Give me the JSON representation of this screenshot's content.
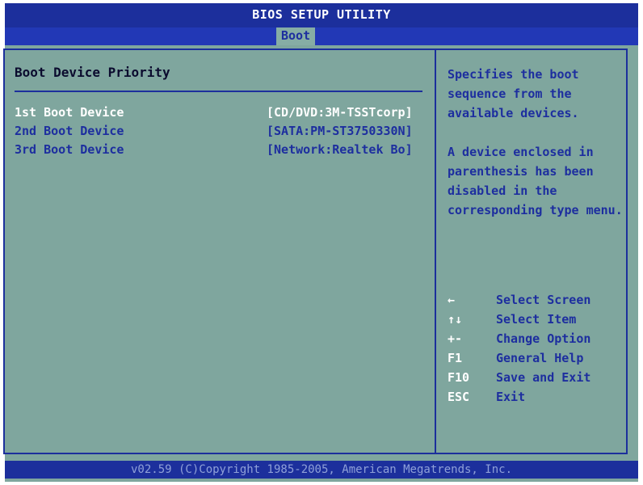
{
  "header": {
    "title": "BIOS SETUP UTILITY",
    "active_tab": "Boot"
  },
  "section": {
    "title": "Boot Device Priority"
  },
  "devices": [
    {
      "label": "1st Boot Device",
      "value": "[CD/DVD:3M-TSSTcorp]"
    },
    {
      "label": "2nd Boot Device",
      "value": "[SATA:PM-ST3750330N]"
    },
    {
      "label": "3rd Boot Device",
      "value": "[Network:Realtek Bo]"
    }
  ],
  "help": {
    "paragraph1": "Specifies the boot sequence from the available devices.",
    "paragraph2": "A device enclosed in parenthesis has been disabled in the corresponding type menu."
  },
  "keys": [
    {
      "key": "←",
      "desc": "Select Screen"
    },
    {
      "key": "↑↓",
      "desc": "Select Item"
    },
    {
      "key": "+-",
      "desc": "Change Option"
    },
    {
      "key": "F1",
      "desc": "General Help"
    },
    {
      "key": "F10",
      "desc": "Save and Exit"
    },
    {
      "key": "ESC",
      "desc": "Exit"
    }
  ],
  "footer": {
    "copyright": "v02.59 (C)Copyright 1985-2005, American Megatrends, Inc."
  },
  "colors": {
    "background": "#7fa69e",
    "bar": "#1c2f9c",
    "text_blue": "#1d2e9f",
    "text_selected": "#ffffff"
  }
}
